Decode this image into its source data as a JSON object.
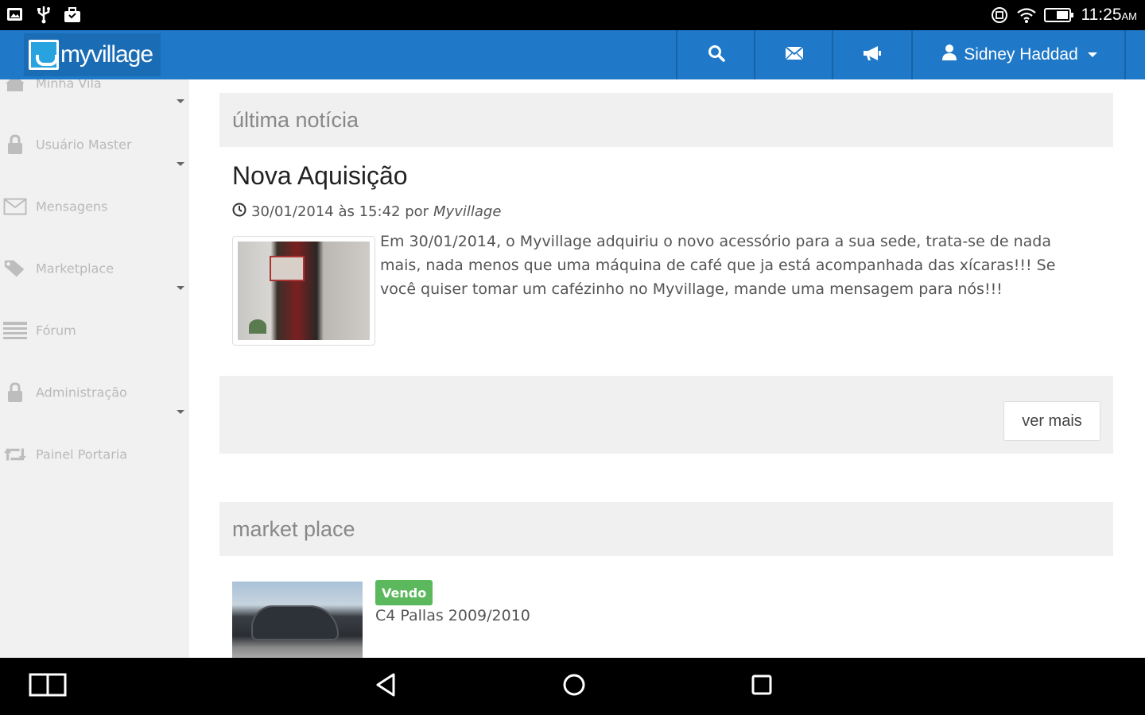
{
  "status_bar": {
    "time": "11:25",
    "ampm": "AM",
    "left_icons": [
      "gallery-icon",
      "usb-icon",
      "bag-icon"
    ],
    "right_icons": [
      "sync-icon",
      "wifi-icon",
      "battery-icon"
    ]
  },
  "navbar": {
    "brand": "myvillage",
    "search_icon": "search-icon",
    "messages_icon": "envelope-icon",
    "announce_icon": "megaphone-icon",
    "user_name": "Sidney Haddad"
  },
  "sidebar": {
    "items": [
      {
        "label": "Minha Vila",
        "icon": "home-icon",
        "has_caret": true
      },
      {
        "label": "Usuário Master",
        "icon": "lock-icon",
        "has_caret": true
      },
      {
        "label": "Mensagens",
        "icon": "envelope-icon",
        "has_caret": false
      },
      {
        "label": "Marketplace",
        "icon": "tags-icon",
        "has_caret": true
      },
      {
        "label": "Fórum",
        "icon": "list-icon",
        "has_caret": false
      },
      {
        "label": "Administração",
        "icon": "lock-icon",
        "has_caret": true
      },
      {
        "label": "Painel Portaria",
        "icon": "retweet-icon",
        "has_caret": false
      }
    ]
  },
  "news_panel": {
    "heading": "última notícia",
    "title": "Nova Aquisição",
    "date": "30/01/2014 às 15:42 por",
    "author": "Myvillage",
    "body": "Em 30/01/2014, o Myvillage adquiriu o novo acessório para a sua sede, trata-se de nada mais, nada menos que uma máquina de café que ja está acompanhada das xícaras!!! Se você quiser tomar um cafézinho no Myvillage, mande uma mensagem para nós!!!",
    "more_button": "ver mais"
  },
  "market_panel": {
    "heading": "market place",
    "item_badge": "Vendo",
    "item_title": "C4 Pallas 2009/2010"
  },
  "colors": {
    "nav_blue": "#1f78c8",
    "badge_green": "#5cb85c"
  }
}
